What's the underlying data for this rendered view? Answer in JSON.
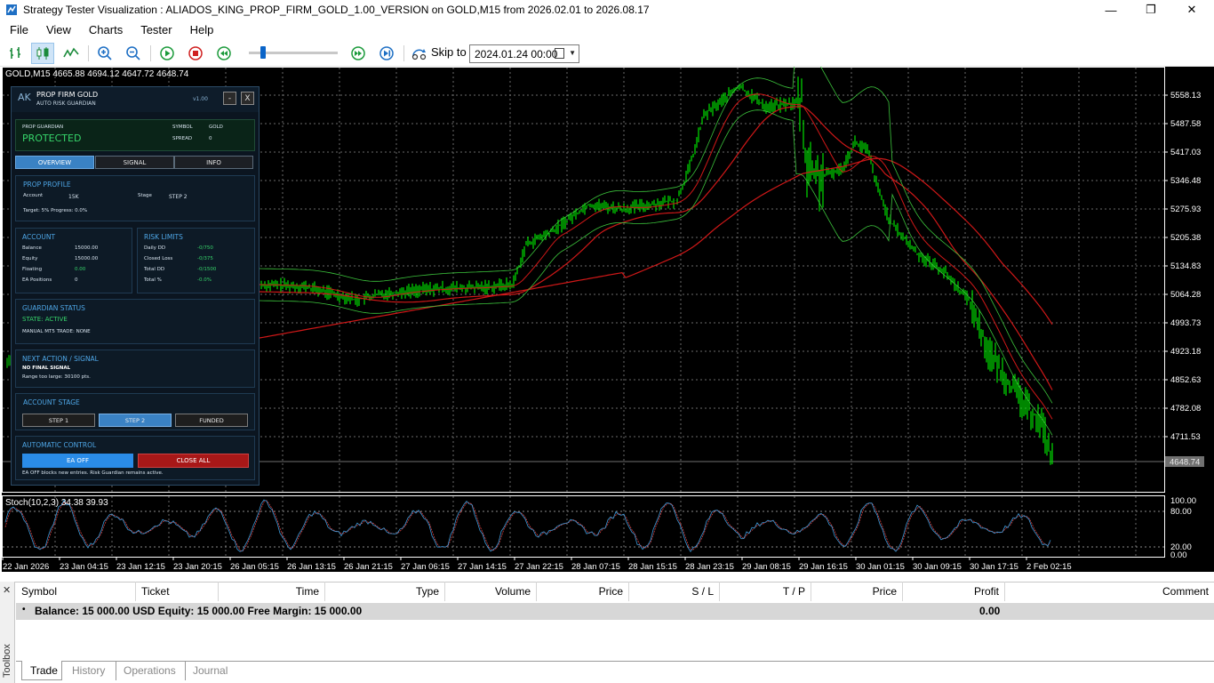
{
  "window": {
    "title": "Strategy Tester Visualization : ALIADOS_KING_PROP_FIRM_GOLD_1.00_VERSION on GOLD,M15 from 2026.02.01 to 2026.08.17",
    "minimize": "—",
    "maximize": "❐",
    "close": "✕"
  },
  "menu": [
    "File",
    "View",
    "Charts",
    "Tester",
    "Help"
  ],
  "toolbar": {
    "skip_label": "Skip to",
    "skip_date": "2024.01.24 00:00",
    "slider_position": 0.15
  },
  "chart": {
    "symbol_info": "GOLD,M15  4665.88 4694.12 4647.72 4648.74",
    "price_labels": [
      "5558.13",
      "5487.58",
      "5417.03",
      "5346.48",
      "5275.93",
      "5205.38",
      "5134.83",
      "5064.28",
      "4993.73",
      "4923.18",
      "4852.63",
      "4782.08",
      "4711.53",
      "4648.74"
    ],
    "current_price": "4648.74",
    "stoch_info": "Stoch(10,2,3) 34.38 39.93",
    "stoch_levels": [
      "100.00",
      "80.00",
      "20.00",
      "0.00"
    ],
    "time_labels": [
      "22 Jan 2026",
      "23 Jan 04:15",
      "23 Jan 12:15",
      "23 Jan 20:15",
      "26 Jan 05:15",
      "26 Jan 13:15",
      "26 Jan 21:15",
      "27 Jan 06:15",
      "27 Jan 14:15",
      "27 Jan 22:15",
      "28 Jan 07:15",
      "28 Jan 15:15",
      "28 Jan 23:15",
      "29 Jan 08:15",
      "29 Jan 16:15",
      "30 Jan 01:15",
      "30 Jan 09:15",
      "30 Jan 17:15",
      "2 Feb 02:15"
    ],
    "colors": {
      "candle": "#00e000",
      "ma_red": "#d01818",
      "band": "#3cc43c",
      "stoch_main": "#3a9ad9",
      "stoch_signal": "#d84040"
    }
  },
  "panel": {
    "logo": "AK",
    "title": "PROP FIRM GOLD",
    "subtitle": "AUTO RISK GUARDIAN",
    "version": "v1.00",
    "min_btn": "-",
    "close_btn": "X",
    "guardian_label": "PROP GUARDIAN",
    "guardian_state": "PROTECTED",
    "symbol_label": "SYMBOL",
    "symbol_value": "GOLD",
    "spread_label": "SPREAD",
    "spread_value": "0",
    "tabs": [
      "OVERVIEW",
      "SIGNAL",
      "INFO"
    ],
    "profile": {
      "title": "PROP PROFILE",
      "account_label": "Account",
      "account_value": "15K",
      "stage_label": "Stage",
      "stage_value": "STEP 2",
      "target_line": "Target: 5%  Progress: 0.0%"
    },
    "account": {
      "title": "ACCOUNT",
      "rows": [
        {
          "label": "Balance",
          "value": "15000.00"
        },
        {
          "label": "Equity",
          "value": "15000.00"
        },
        {
          "label": "Floating",
          "value": "0.00"
        },
        {
          "label": "EA Positions",
          "value": "0"
        }
      ]
    },
    "risk": {
      "title": "RISK LIMITS",
      "rows": [
        {
          "label": "Daily DD",
          "value": "-0/750"
        },
        {
          "label": "Closed Loss",
          "value": "-0/375"
        },
        {
          "label": "Total DD",
          "value": "-0/1500"
        },
        {
          "label": "Total %",
          "value": "-0.0%"
        }
      ]
    },
    "guardian_status": {
      "title": "GUARDIAN STATUS",
      "state": "STATE: ACTIVE",
      "manual": "MANUAL MT5 TRADE: NONE"
    },
    "next_action": {
      "title": "NEXT ACTION / SIGNAL",
      "line1": "NO FINAL SIGNAL",
      "line2": "Range too large: 30100 pts."
    },
    "stage": {
      "title": "ACCOUNT STAGE",
      "buttons": [
        "STEP 1",
        "STEP 2",
        "FUNDED"
      ]
    },
    "control": {
      "title": "AUTOMATIC CONTROL",
      "ea_btn": "EA OFF",
      "close_all_btn": "CLOSE ALL",
      "note": "EA OFF blocks new entries. Risk Guardian remains active."
    }
  },
  "toolbox": {
    "side_label": "Toolbox",
    "close": "✕",
    "columns": [
      "Symbol",
      "Ticket",
      "Time",
      "Type",
      "Volume",
      "Price",
      "S / L",
      "T / P",
      "Price",
      "Profit",
      "Comment"
    ],
    "balance_line": "Balance: 15 000.00 USD  Equity: 15 000.00  Free Margin: 15 000.00",
    "profit": "0.00",
    "tabs": [
      "Trade",
      "History",
      "Operations",
      "Journal"
    ]
  }
}
